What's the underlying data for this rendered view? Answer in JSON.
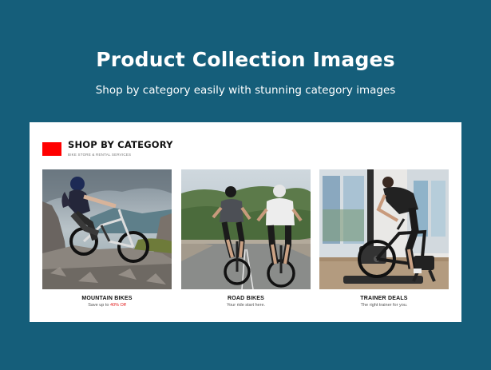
{
  "hero": {
    "title": "Product Collection Images",
    "subtitle": "Shop by category easily with stunning category images"
  },
  "section": {
    "title": "SHOP BY CATEGORY",
    "subtitle": "BIKE STORE & RENTAL SERVICES",
    "accent_color": "#ff0000"
  },
  "categories": [
    {
      "title": "MOUNTAIN BIKES",
      "desc_prefix": "Save up to",
      "desc_highlight": "40% Off",
      "image_desc": "mountain-biker-on-rocks"
    },
    {
      "title": "ROAD BIKES",
      "desc": "Your ride start here.",
      "image_desc": "two-road-cyclists"
    },
    {
      "title": "TRAINER DEALS",
      "desc": "The right trainer for you.",
      "image_desc": "indoor-bike-trainer"
    }
  ],
  "colors": {
    "background": "#155e7a",
    "card": "#ffffff",
    "highlight": "#e21b1b"
  }
}
